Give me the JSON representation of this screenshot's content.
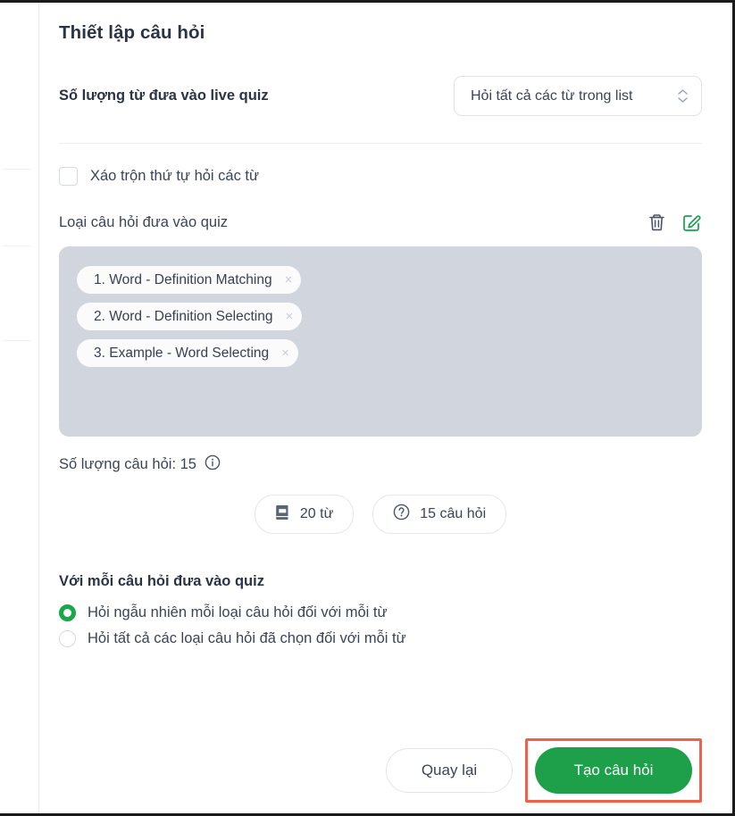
{
  "page": {
    "title": "Thiết lập câu hỏi"
  },
  "word_count_row": {
    "label": "Số lượng từ đưa vào live quiz",
    "select_value": "Hỏi tất cả các từ trong list"
  },
  "shuffle": {
    "label": "Xáo trộn thứ tự hỏi các từ",
    "checked": "false"
  },
  "question_types": {
    "label": "Loại câu hỏi đưa vào quiz",
    "delete_icon": "trash-icon",
    "edit_icon": "edit-square-icon",
    "tags": [
      {
        "text": "1. Word - Definition Matching",
        "close": "×"
      },
      {
        "text": "2. Word - Definition Selecting",
        "close": "×"
      },
      {
        "text": "3. Example - Word Selecting",
        "close": "×"
      }
    ]
  },
  "question_count": {
    "text": "Số lượng câu hỏi: 15",
    "info_icon": "info-circle-icon"
  },
  "stats": [
    {
      "icon": "book-icon",
      "label": "20 từ"
    },
    {
      "icon": "question-circle-icon",
      "label": "15 câu hỏi"
    }
  ],
  "per_question": {
    "title": "Với mỗi câu hỏi đưa vào quiz",
    "options": [
      {
        "label": "Hỏi ngẫu nhiên mỗi loại câu hỏi đối với mỗi từ",
        "selected": "true"
      },
      {
        "label": "Hỏi tất cả các loại câu hỏi đã chọn đối với mỗi từ",
        "selected": "false"
      }
    ]
  },
  "footer": {
    "back_label": "Quay lại",
    "create_label": "Tạo câu hỏi"
  },
  "colors": {
    "accent_green": "#1ea04a",
    "radio_green": "#18a849",
    "highlight_red": "#f0614a",
    "panel_gray": "#d1d5dd",
    "text_dark": "#2b3445"
  }
}
